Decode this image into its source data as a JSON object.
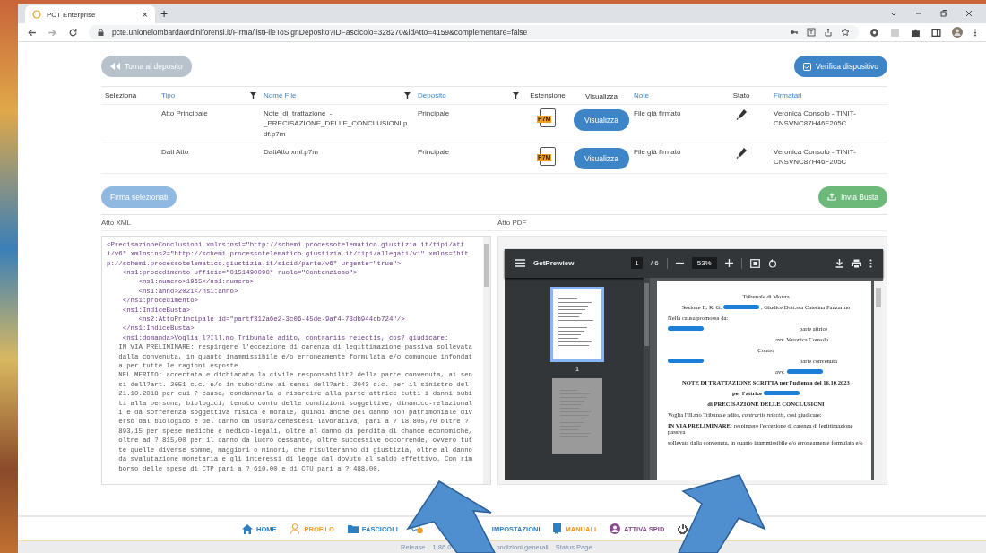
{
  "browser": {
    "tab_title": "PCT Enterprise",
    "tab_close": "×",
    "new_tab": "+",
    "url": "pcte.unionelombardaordiniforensi.it/Firma/listFileToSignDeposito?IDFascicolo=328270&idAtto=4159&complementare=false"
  },
  "actions": {
    "back": "Torna al deposito",
    "verify": "Verifica dispositivo",
    "sign": "Firma selezionati",
    "send": "Invia Busta"
  },
  "table": {
    "columns": [
      {
        "label": "Seleziona",
        "link": false,
        "filter": false
      },
      {
        "label": "Tipo",
        "link": true,
        "filter": true
      },
      {
        "label": "Nome File",
        "link": true,
        "filter": true
      },
      {
        "label": "Deposito",
        "link": true,
        "filter": true
      },
      {
        "label": "Estensione",
        "link": false,
        "filter": false
      },
      {
        "label": "Visualizza",
        "link": false,
        "filter": false
      },
      {
        "label": "Note",
        "link": true,
        "filter": false
      },
      {
        "label": "Stato",
        "link": false,
        "filter": false
      },
      {
        "label": "Firmatari",
        "link": true,
        "filter": false
      }
    ],
    "rows": [
      {
        "tipo": "Atto Principale",
        "nome_file": "Note_di_trattazione_-_PRECISAZIONE_DELLE_CONCLUSIONI.pdf.p7m",
        "deposito": "Principale",
        "estensione": "P7M",
        "visualizza": "Visualizza",
        "note": "File già firmato",
        "firmatari": "Veronica Consolo - TINIT-CNSVNC87H46F205C"
      },
      {
        "tipo": "Dati Atto",
        "nome_file": "DatiAtto.xml.p7m",
        "deposito": "Principale",
        "estensione": "P7M",
        "visualizza": "Visualizza",
        "note": "File già firmato",
        "firmatari": "Veronica Consolo - TINIT-CNSVNC87H46F205C"
      }
    ]
  },
  "xml_panel": {
    "title": "Atto XML",
    "lines": [
      {
        "kind": "markup",
        "text": "<PrecisazioneConclusioni xmlns:ns1=\"http://schemi.processotelematico.giustizia.it/tipi/att"
      },
      {
        "kind": "markup",
        "text": "i/v6\" xmlns:ns2=\"http://schemi.processotelematico.giustizia.it/tipi/allegati/v1\" xmlns=\"htt"
      },
      {
        "kind": "markup",
        "text": "p://schemi.processotelematico.giustizia.it/sicid/parte/v6\" urgente=\"true\">"
      },
      {
        "kind": "markup",
        "text": "    <ns1:procedimento ufficio=\"0151490090\" ruolo=\"Contenzioso\">"
      },
      {
        "kind": "markup",
        "text": "        <ns1:numero>1965</ns1:numero>"
      },
      {
        "kind": "markup",
        "text": "        <ns1:anno>2021</ns1:anno>"
      },
      {
        "kind": "markup",
        "text": "    </ns1:procedimento>"
      },
      {
        "kind": "markup",
        "text": "    <ns1:IndiceBusta>"
      },
      {
        "kind": "markup",
        "text": "        <ns2:AttoPrincipale id=\"partf312a6e2-3c06-45de-9af4-73db944cb724\"/>"
      },
      {
        "kind": "markup",
        "text": "    </ns1:IndiceBusta>"
      },
      {
        "kind": "markup",
        "text": "    <ns1:domanda>Voglia l?Ill.mo Tribunale adito, contrariis reiectis, cos? giudicare:"
      },
      {
        "kind": "text",
        "text": "   IN VIA PRELIMINARE: respingere l'eccezione di carenza di legittimazione passiva sollevata"
      },
      {
        "kind": "text",
        "text": "   dalla convenuta, in quanto inammissibile e/o erroneamente formulata e/o comunque infondat"
      },
      {
        "kind": "text",
        "text": "   a per tutte le ragioni esposte."
      },
      {
        "kind": "text",
        "text": "   NEL MERITO: accertata e dichiarata la civile responsabilit? della parte convenuta, ai sen"
      },
      {
        "kind": "text",
        "text": "   si dell?art. 2051 c.c. e/o in subordine ai sensi dell?art. 2043 c.c. per il sinistro del"
      },
      {
        "kind": "text",
        "text": "   21.10.2018 per cui ? causa, condannarla a risarcire alla parte attrice tutti i danni subi"
      },
      {
        "kind": "text",
        "text": "   ti alla persona, biologici, tenuto conto delle condizioni soggettive, dinamico-relazional"
      },
      {
        "kind": "text",
        "text": "   i e da sofferenza soggettiva fisica e morale, quindi anche del danno non patrimoniale div"
      },
      {
        "kind": "text",
        "text": "   erso dal biologico e del danno da usura/cenestesi lavorativa, pari a ? 18.805,70 oltre ?"
      },
      {
        "kind": "text",
        "text": "   893,15 per spese mediche e medico-legali, oltre al danno da perdita di chance economiche,"
      },
      {
        "kind": "text",
        "text": "   oltre ad ? 815,00 per il danno da lucro cessante, oltre successive occorrende, ovvero tut"
      },
      {
        "kind": "text",
        "text": "   te quelle diverse somme, maggiori o minori, che risulteranno di giustizia, oltre al danno"
      },
      {
        "kind": "text",
        "text": "   da svalutazione monetaria e gli interessi di legge dal dovuto al saldo effettivo. Con rim"
      },
      {
        "kind": "text",
        "text": "   borso delle spese di CTP pari a ? 610,00 e di CTU pari a ? 488,00."
      }
    ]
  },
  "pdf_panel": {
    "title": "Atto PDF",
    "viewer": {
      "doc_title": "GetPrewiew",
      "page": "1",
      "page_count": "/ 6",
      "zoom": "53%",
      "thumbnails": [
        {
          "label": "1",
          "selected": true
        },
        {
          "selected": false
        }
      ],
      "page_lines": [
        {
          "kind": "center",
          "bold": false,
          "parts": [
            {
              "kind": "text",
              "text": "Tribunale di Monza"
            }
          ]
        },
        {
          "kind": "center",
          "bold": false,
          "parts": [
            {
              "kind": "text",
              "text": "Sezione II, R. G."
            },
            {
              "kind": "redaction"
            },
            {
              "kind": "text",
              "text": ", Giudice Dott.ssa Caterina Panzarino"
            }
          ]
        },
        {
          "kind": "left",
          "bold": false,
          "parts": [
            {
              "kind": "text",
              "text": "Nella causa promossa da:"
            }
          ]
        },
        {
          "kind": "split",
          "bold": false,
          "parts": [
            {
              "kind": "redaction"
            },
            {
              "kind": "text",
              "text": "parte attrice"
            }
          ]
        },
        {
          "kind": "column",
          "bold": false,
          "parts": [
            {
              "kind": "text",
              "text": "avv. Veronica Consolo"
            }
          ]
        },
        {
          "kind": "center",
          "bold": false,
          "parts": [
            {
              "kind": "text",
              "text": "Contro"
            }
          ]
        },
        {
          "kind": "split",
          "bold": false,
          "parts": [
            {
              "kind": "redaction"
            },
            {
              "kind": "text",
              "text": "parte convenuta"
            }
          ]
        },
        {
          "kind": "column",
          "bold": false,
          "parts": [
            {
              "kind": "text",
              "text": "avv."
            },
            {
              "kind": "redaction"
            }
          ]
        },
        {
          "kind": "center",
          "bold": true,
          "parts": [
            {
              "kind": "text",
              "text": "NOTE DI TRATTAZIONE SCRITTA per l'udienza del 16.10.2023"
            }
          ]
        },
        {
          "kind": "center",
          "bold": true,
          "parts": [
            {
              "kind": "text",
              "text": "per l'attrice"
            },
            {
              "kind": "redaction"
            }
          ]
        },
        {
          "kind": "center",
          "bold": true,
          "parts": [
            {
              "kind": "text",
              "text": "di PRECISAZIONE DELLE CONCLUSIONI"
            }
          ]
        },
        {
          "kind": "left",
          "bold": false,
          "parts": [
            {
              "kind": "text",
              "text": "Voglia l'Ill.mo Tribunale adito, *contrariis reiectis*, così giudicare:"
            }
          ]
        },
        {
          "kind": "left",
          "bold": false,
          "parts": [
            {
              "kind": "text",
              "text": "**IN VIA PRELIMINARE:** respingere l'eccezione di carenza di legittimazione passiva"
            }
          ]
        },
        {
          "kind": "left",
          "bold": false,
          "parts": [
            {
              "kind": "text",
              "text": "sollevata dalla convenuta, in quanto inammissibile e/o erroneamente formulata e/o"
            }
          ]
        }
      ]
    }
  },
  "footer_nav": [
    {
      "kind": "home",
      "label": "HOME",
      "color": "#2e7fc0"
    },
    {
      "kind": "profile",
      "label": "PROFILO",
      "color": "#f09a2a"
    },
    {
      "kind": "folder",
      "label": "FASCICOLI",
      "color": "#2e7fc0"
    },
    {
      "kind": "chat",
      "color": "#f09a2a"
    },
    {
      "kind": "text",
      "label": "IMPOSTAZIONI",
      "color": "#2e7fc0"
    },
    {
      "kind": "manual",
      "label": "MANUALI",
      "color": "#f09a2a"
    },
    {
      "kind": "spid",
      "label": "ATTIVA SPID",
      "color": "#8a4a8c"
    },
    {
      "kind": "power",
      "color": "#555555"
    }
  ],
  "status_bar": [
    "Release",
    "1.86.0",
    "ondizioni generali",
    "Status Page"
  ]
}
